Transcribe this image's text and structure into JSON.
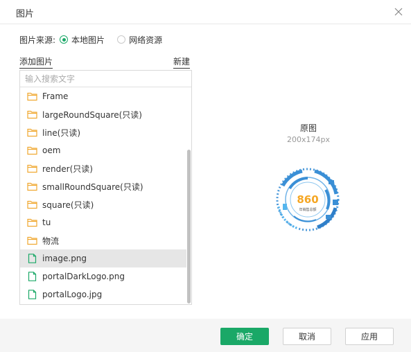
{
  "dialog": {
    "title": "图片"
  },
  "source": {
    "label": "图片来源:",
    "options": [
      {
        "label": "本地图片",
        "checked": true
      },
      {
        "label": "网络资源",
        "checked": false
      }
    ]
  },
  "panel": {
    "add_label": "添加图片",
    "new_label": "新建",
    "search_placeholder": "输入搜索文字"
  },
  "tree": [
    {
      "label": "Frame",
      "type": "folder"
    },
    {
      "label": "largeRoundSquare(只读)",
      "type": "folder"
    },
    {
      "label": "line(只读)",
      "type": "folder"
    },
    {
      "label": "oem",
      "type": "folder"
    },
    {
      "label": "render(只读)",
      "type": "folder"
    },
    {
      "label": "smallRoundSquare(只读)",
      "type": "folder"
    },
    {
      "label": "square(只读)",
      "type": "folder"
    },
    {
      "label": "tu",
      "type": "folder"
    },
    {
      "label": "物流",
      "type": "folder"
    },
    {
      "label": "image.png",
      "type": "file",
      "selected": true
    },
    {
      "label": "portalDarkLogo.png",
      "type": "file"
    },
    {
      "label": "portalLogo.jpg",
      "type": "file"
    }
  ],
  "preview": {
    "title": "原图",
    "size": "200x174px",
    "image_value": "860",
    "image_caption": "年销售总额"
  },
  "buttons": {
    "ok": "确定",
    "cancel": "取消",
    "apply": "应用"
  },
  "colors": {
    "accent": "#1aa867",
    "folder_icon": "#f0a830",
    "file_icon": "#1aa867",
    "preview_blue": "#3a8fd6",
    "preview_orange": "#f5a623"
  }
}
